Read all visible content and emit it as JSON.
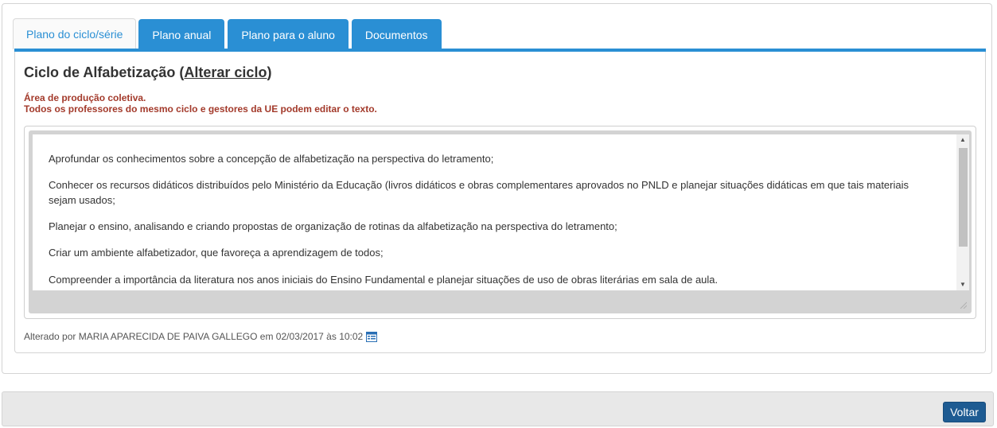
{
  "tabs": [
    {
      "label": "Plano do ciclo/série",
      "active": true
    },
    {
      "label": "Plano anual",
      "active": false
    },
    {
      "label": "Plano para o aluno",
      "active": false
    },
    {
      "label": "Documentos",
      "active": false
    }
  ],
  "panel": {
    "title_prefix": "Ciclo de Alfabetização",
    "title_link": "Alterar ciclo",
    "notice_line1": "Área de produção coletiva.",
    "notice_line2": "Todos os professores do mesmo ciclo e gestores da UE podem editar o texto."
  },
  "editor": {
    "paragraphs": [
      "Aprofundar os conhecimentos sobre a concepção de alfabetização na perspectiva do letramento;",
      "Conhecer os recursos didáticos distribuídos pelo Ministério da Educação (livros didáticos e obras complementares aprovados no PNLD e planejar situações didáticas em que tais materiais sejam usados;",
      "Planejar o ensino, analisando e criando propostas de organização de rotinas da alfabetização na perspectiva do letramento;",
      "Criar um ambiente alfabetizador, que favoreça a aprendizagem de todos;",
      "Compreender a importância da literatura nos anos iniciais do Ensino Fundamental e planejar situações de uso de obras literárias em sala de aula."
    ]
  },
  "audit": {
    "text": "Alterado por MARIA APARECIDA DE PAIVA GALLEGO em 02/03/2017 às 10:02",
    "icon": "history-icon"
  },
  "footer": {
    "voltar_label": "Voltar"
  },
  "colors": {
    "tab_blue": "#2a8fd4",
    "notice_red": "#a33a2b",
    "button_navy": "#1e5b92"
  }
}
